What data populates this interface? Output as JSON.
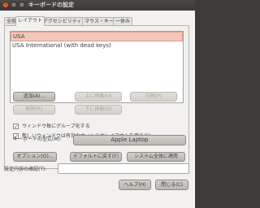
{
  "window": {
    "title": "キーボードの設定"
  },
  "tabs": [
    {
      "label": "全般"
    },
    {
      "label": "レイアウト"
    },
    {
      "label": "アクセシビリティ"
    },
    {
      "label": "マウス・キー"
    },
    {
      "label": "一休み"
    }
  ],
  "layouts": [
    {
      "name": "USA",
      "selected": true
    },
    {
      "name": "USA International (with dead keys)",
      "selected": false
    }
  ],
  "layout_buttons": {
    "add": "追加(A)...",
    "move_up": "上に移動(U)",
    "print": "印刷(P)",
    "remove": "削除(R)",
    "move_down": "下に移動(D)"
  },
  "options": {
    "group_per_window": {
      "label": "ウィンドウ毎にグループ化する",
      "checked": true
    },
    "new_window_active": {
      "label": "新しいウィンドウは有効なウィンドウレイアウトを使う(S)",
      "checked": true
    }
  },
  "model": {
    "label": "キーボードの型式(M):",
    "value": "Apple Laptop"
  },
  "action_buttons": {
    "options": "オプション(O)...",
    "reset_default": "デフォルトに戻す(F)",
    "apply_system": "システム全体に適用"
  },
  "test_field": {
    "label": "設定内容の確認(T):",
    "value": ""
  },
  "dialog_buttons": {
    "help": "ヘルプ(H)",
    "close": "閉じる(C)"
  },
  "colors": {
    "accent": "#dd4814",
    "selection": "#f0c8bd"
  }
}
